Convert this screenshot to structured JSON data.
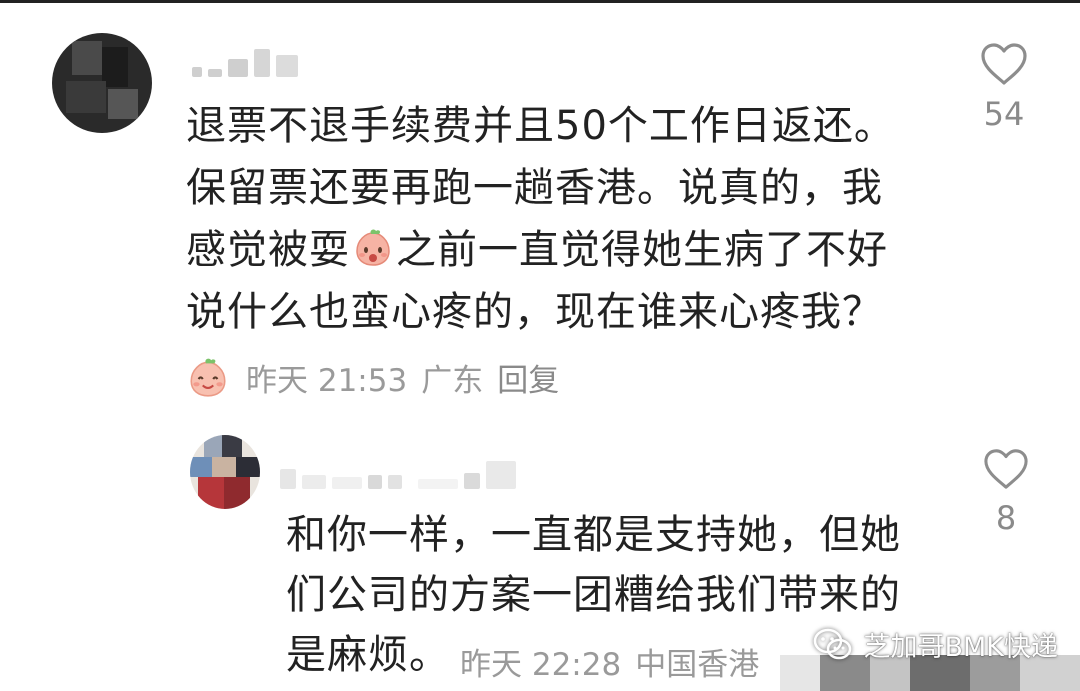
{
  "main_comment": {
    "text_lines": [
      "退票不退手续费并且50个工作日返还。",
      "保留票还要再跑一趟香港。说真的，我",
      "感觉被耍",
      "之前一直觉得她生病了不好",
      "说什么也蛮心疼的，现在谁来心疼我？"
    ],
    "time": "昨天 21:53",
    "location": "广东",
    "reply_label": "回复",
    "like_count": "54"
  },
  "reply_comment": {
    "text_lines": [
      "和你一样，一直都是支持她，但她",
      "们公司的方案一团糟给我们带来的",
      "是麻烦。"
    ],
    "time": "昨天 22:28",
    "location": "中国香港",
    "like_count": "8"
  },
  "watermark": {
    "text": "芝加哥BMK快递"
  },
  "icons": {
    "like": "heart-outline-icon",
    "emoji": "peach-face-emoji",
    "watermark": "wechat-icon"
  },
  "colors": {
    "text": "#222222",
    "meta": "#9a9a9a",
    "icon": "#8d8d8d"
  }
}
